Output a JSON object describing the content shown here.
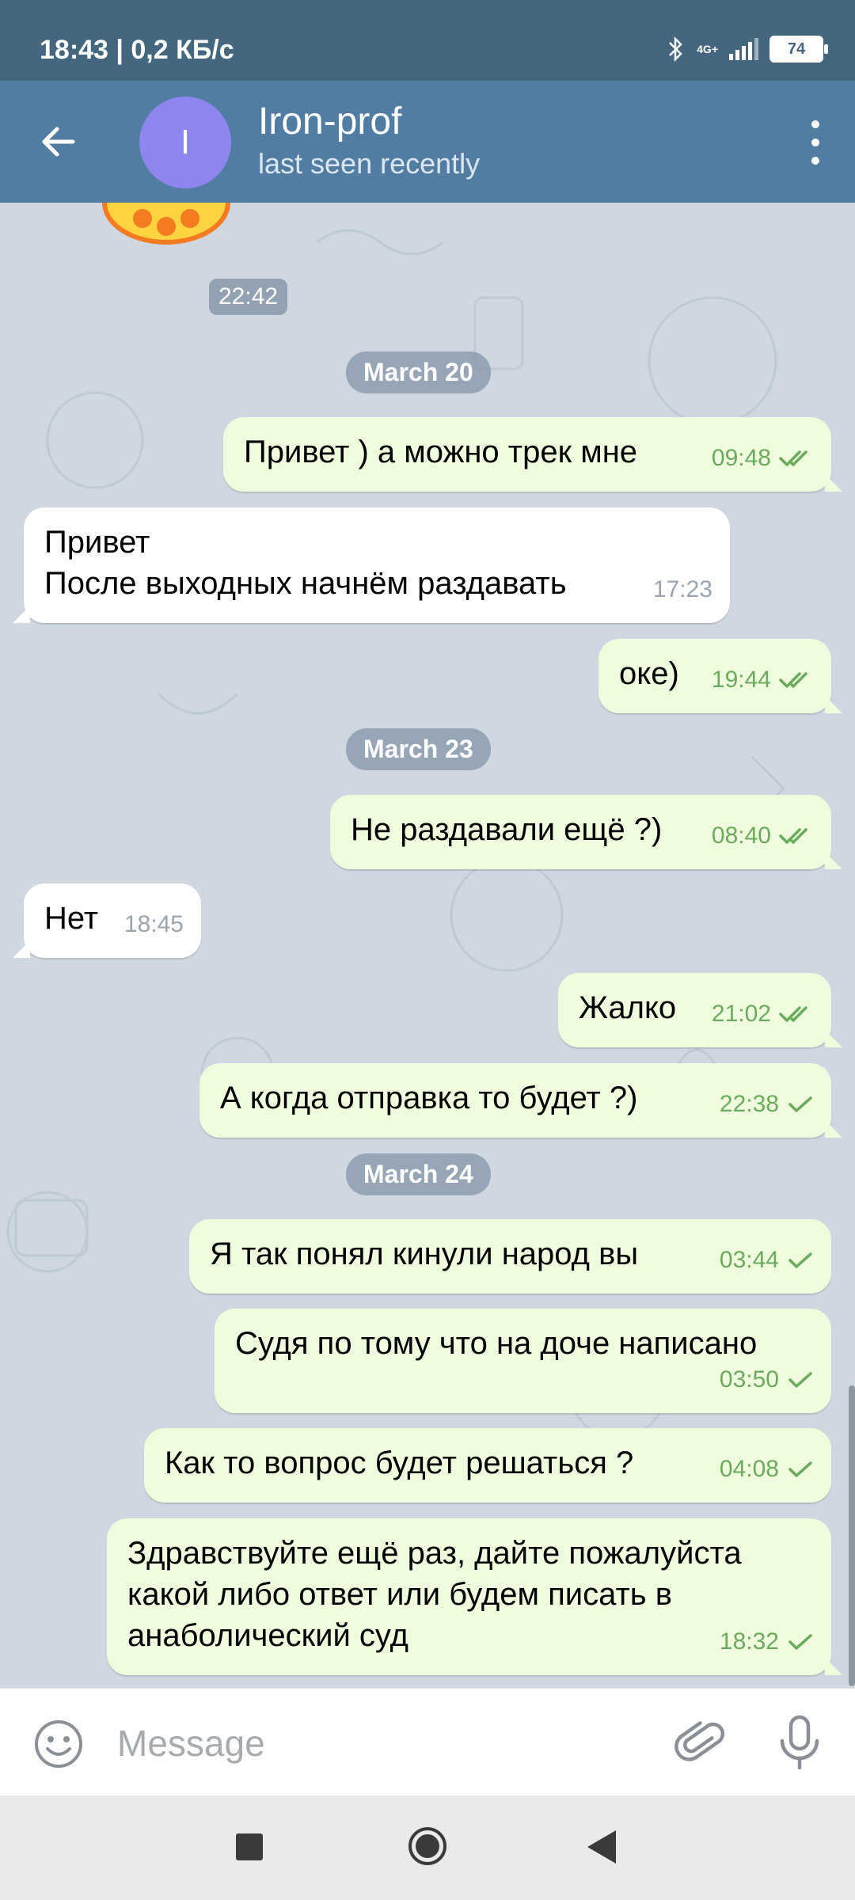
{
  "status_bar": {
    "time": "18:43 | 0,2 КБ/с",
    "network": "4G+",
    "battery": "74"
  },
  "header": {
    "avatar_letter": "I",
    "contact_name": "Iron-prof",
    "status": "last seen recently"
  },
  "chat": {
    "top_time": "22:42",
    "dates": [
      "March 20",
      "March 23",
      "March 24"
    ],
    "messages": [
      {
        "dir": "out",
        "text": "Привет ) а можно трек мне",
        "time": "09:48",
        "status": "read"
      },
      {
        "dir": "in",
        "text": "Привет\nПосле выходных начнём раздавать",
        "time": "17:23"
      },
      {
        "dir": "out",
        "text": "оке)",
        "time": "19:44",
        "status": "read"
      },
      {
        "dir": "out",
        "text": "Не раздавали ещё ?)",
        "time": "08:40",
        "status": "read"
      },
      {
        "dir": "in",
        "text": "Нет",
        "time": "18:45"
      },
      {
        "dir": "out",
        "text": "Жалко",
        "time": "21:02",
        "status": "read"
      },
      {
        "dir": "out",
        "text": "А когда отправка то будет ?)",
        "time": "22:38",
        "status": "sent"
      },
      {
        "dir": "out",
        "text": "Я так понял кинули народ вы",
        "time": "03:44",
        "status": "sent"
      },
      {
        "dir": "out",
        "text": "Судя по тому что на доче написано",
        "time": "03:50",
        "status": "sent"
      },
      {
        "dir": "out",
        "text": "Как то вопрос будет решаться ?",
        "time": "04:08",
        "status": "sent"
      },
      {
        "dir": "out",
        "text": "Здравствуйте ещё раз, дайте пожалуйста\nкакой либо ответ или будем писать в\nанаболический суд",
        "time": "18:32",
        "status": "sent"
      }
    ]
  },
  "input": {
    "placeholder": "Message"
  },
  "colors": {
    "header": "#527da3",
    "status_bar": "#45667f",
    "outgoing_bubble": "#effdde",
    "incoming_bubble": "#ffffff",
    "check_green": "#6bab5e",
    "avatar": "#8e85ee"
  },
  "icons": [
    "back-arrow-icon",
    "more-vert-icon",
    "emoji-icon",
    "attach-icon",
    "mic-icon",
    "bluetooth-icon",
    "signal-icon",
    "battery-icon"
  ]
}
